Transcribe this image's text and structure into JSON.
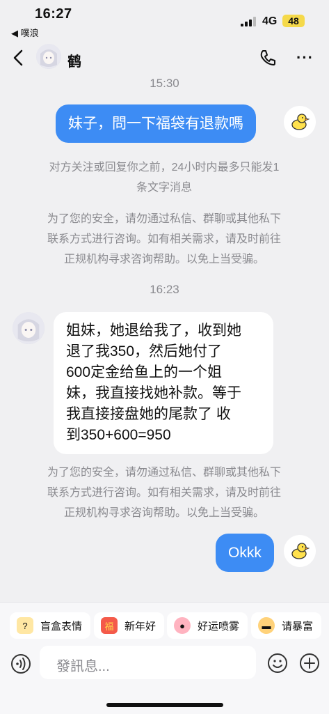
{
  "status": {
    "time": "16:27",
    "back_app": "◀ 噗浪",
    "network": "4G",
    "battery": "48"
  },
  "header": {
    "contact_name": "鹤"
  },
  "messages": {
    "ts1": "15:30",
    "me1": "妹子，問一下福袋有退款嗎",
    "sys1_line1": "对方关注或回复你之前，24小时内最多只能发1",
    "sys1_line2": "条文字消息",
    "sys2_line1": "为了您的安全，请勿通过私信、群聊或其他私下",
    "sys2_line2": "联系方式进行咨询。如有相关需求，请及时前往",
    "sys2_line3": "正规机构寻求咨询帮助。以免上当受骗。",
    "ts2": "16:23",
    "other1_l1": "姐妹，她退给我了，收到她",
    "other1_l2": "退了我350，然后她付了",
    "other1_l3": "600定金给鱼上的一个姐",
    "other1_l4": "妹，我直接找她补款。等于",
    "other1_l5": "我直接接盘她的尾款了 收",
    "other1_l6": "到350+600=950",
    "sys3_line1": "为了您的安全，请勿通过私信、群聊或其他私下",
    "sys3_line2": "联系方式进行咨询。如有相关需求，请及时前往",
    "sys3_line3": "正规机构寻求咨询帮助。以免上当受骗。",
    "me2": "Okkk"
  },
  "quick_replies": [
    {
      "label": "盲盒表情",
      "icon": "question-box-icon"
    },
    {
      "label": "新年好",
      "icon": "red-envelope-icon"
    },
    {
      "label": "好运喷雾",
      "icon": "pig-icon"
    },
    {
      "label": "请暴富",
      "icon": "sunglasses-icon"
    }
  ],
  "composer": {
    "placeholder": "發訊息..."
  },
  "colors": {
    "accent": "#3d8cf4",
    "background": "#f0f0f2",
    "battery": "#f5d94a"
  }
}
